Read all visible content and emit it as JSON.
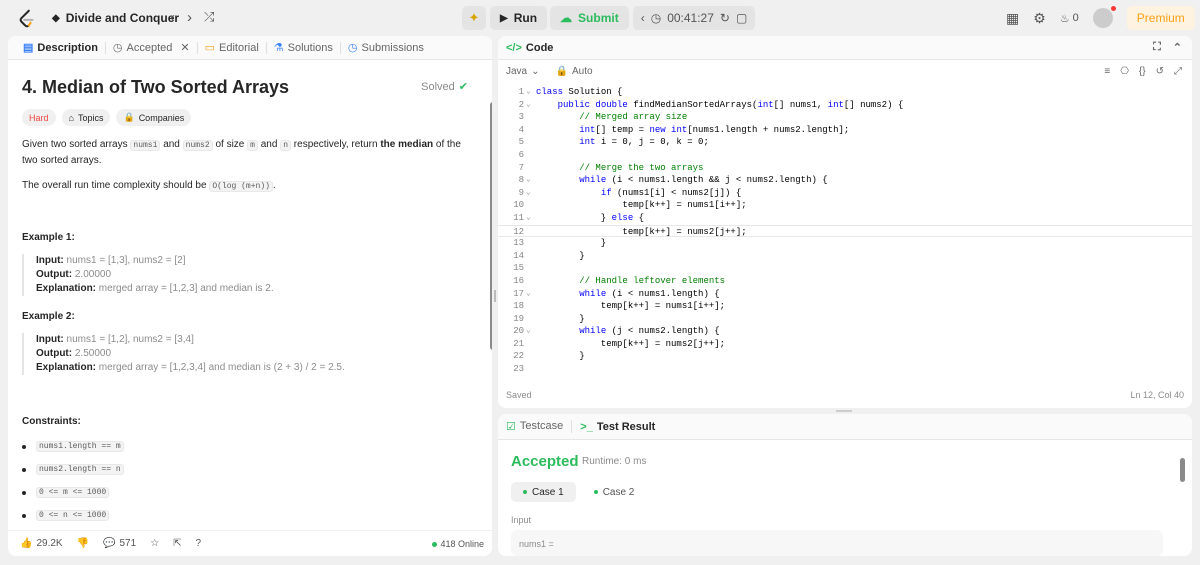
{
  "topbar": {
    "problem_list_name": "Divide and Conquer",
    "run_label": "Run",
    "submit_label": "Submit",
    "timer": "00:41:27",
    "streak_count": "0",
    "premium_label": "Premium"
  },
  "left_tabs": [
    {
      "label": "Description"
    },
    {
      "label": "Accepted"
    },
    {
      "label": "Editorial"
    },
    {
      "label": "Solutions"
    },
    {
      "label": "Submissions"
    }
  ],
  "problem": {
    "title": "4. Median of Two Sorted Arrays",
    "solved_label": "Solved",
    "difficulty": "Hard",
    "topics_label": "Topics",
    "companies_label": "Companies",
    "desc_1": "Given two sorted arrays",
    "code_nums1": "nums1",
    "desc_and": "and",
    "code_nums2": "nums2",
    "desc_of_size": "of size",
    "code_m": "m",
    "desc_and2": "and",
    "code_n": "n",
    "desc_respectively": "respectively, return",
    "desc_median": "the median",
    "desc_of_the": "of the two sorted arrays.",
    "complexity_text": "The overall run time complexity should be",
    "complexity_code": "O(log (m+n))",
    "complexity_period": "."
  },
  "examples": [
    {
      "heading": "Example 1:",
      "input_label": "Input:",
      "input_value": "nums1 = [1,3], nums2 = [2]",
      "output_label": "Output:",
      "output_value": "2.00000",
      "expl_label": "Explanation:",
      "expl_value": "merged array = [1,2,3] and median is 2."
    },
    {
      "heading": "Example 2:",
      "input_label": "Input:",
      "input_value": "nums1 = [1,2], nums2 = [3,4]",
      "output_label": "Output:",
      "output_value": "2.50000",
      "expl_label": "Explanation:",
      "expl_value": "merged array = [1,2,3,4] and median is (2 + 3) / 2 = 2.5."
    }
  ],
  "constraints": {
    "heading": "Constraints:",
    "items": [
      "nums1.length == m",
      "nums2.length == n",
      "0 <= m <= 1000",
      "0 <= n <= 1000"
    ]
  },
  "left_footer": {
    "likes": "29.2K",
    "comments": "571",
    "online": "418 Online"
  },
  "editor": {
    "tab_label": "Code",
    "language": "Java",
    "mode": "Auto",
    "saved_label": "Saved",
    "cursor_pos": "Ln 12, Col 40"
  },
  "tests": {
    "tab_testcase": "Testcase",
    "tab_result": "Test Result",
    "status": "Accepted",
    "runtime": "Runtime: 0 ms",
    "cases": [
      "Case 1",
      "Case 2"
    ],
    "input_label": "Input",
    "input_first": "nums1 ="
  },
  "colors": {
    "accent_green": "#2cbb5d",
    "hard_red": "#ef4743",
    "premium_orange": "#ffa116"
  }
}
